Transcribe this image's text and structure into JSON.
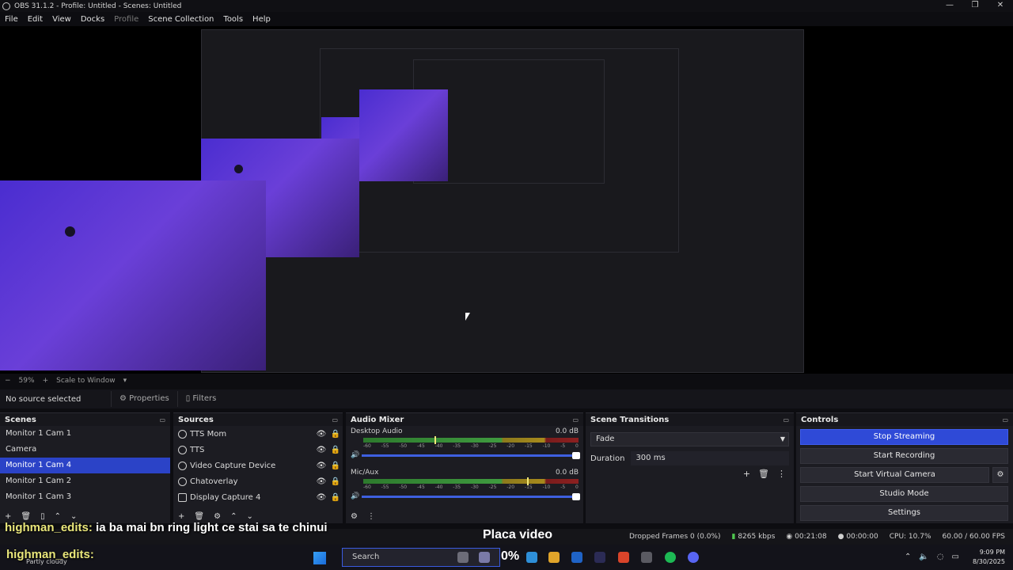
{
  "window": {
    "title": "OBS 31.1.2 - Profile: Untitled - Scenes: Untitled"
  },
  "menu": [
    "File",
    "Edit",
    "View",
    "Docks",
    "Profile",
    "Scene Collection",
    "Tools",
    "Help"
  ],
  "preview_toolbar": {
    "zoom": "59%",
    "scale_mode": "Scale to Window"
  },
  "source_bar": {
    "status": "No source selected",
    "properties": "Properties",
    "filters": "Filters"
  },
  "scenes": {
    "title": "Scenes",
    "items": [
      "Monitor 1 Cam 1",
      "Camera",
      "Monitor 1 Cam 4",
      "Monitor 1 Cam 2",
      "Monitor 1 Cam 3"
    ],
    "selected_index": 2
  },
  "sources": {
    "title": "Sources",
    "items": [
      "TTS Mom",
      "TTS",
      "Video Capture Device",
      "Chatoverlay",
      "Display Capture 4"
    ]
  },
  "mixer": {
    "title": "Audio Mixer",
    "channels": [
      {
        "name": "Desktop Audio",
        "db": "0.0 dB",
        "peak_fraction": 0.33
      },
      {
        "name": "Mic/Aux",
        "db": "0.0 dB",
        "peak_fraction": 0.76
      }
    ],
    "scale": [
      "-60",
      "-55",
      "-50",
      "-45",
      "-40",
      "-35",
      "-30",
      "-25",
      "-20",
      "-15",
      "-10",
      "-5",
      "0"
    ]
  },
  "transitions": {
    "title": "Scene Transitions",
    "selected": "Fade",
    "duration_label": "Duration",
    "duration_value": "300 ms"
  },
  "controls": {
    "title": "Controls",
    "stop_streaming": "Stop Streaming",
    "start_recording": "Start Recording",
    "start_virtual_camera": "Start Virtual Camera",
    "studio_mode": "Studio Mode",
    "settings": "Settings"
  },
  "status": {
    "dropped": "Dropped Frames 0 (0.0%)",
    "bitrate": "8265 kbps",
    "stream_time": "00:21:08",
    "rec_time": "00:00:00",
    "cpu": "CPU: 10.7%",
    "fps": "60.00 / 60.00 FPS"
  },
  "overlay": {
    "chat_user": "highman_edits:",
    "chat_message": "ia ba mai bn ring light ce stai sa te chinui",
    "title": "Placa video",
    "percent": "0%",
    "weather": "Partly cloudy"
  },
  "taskbar": {
    "search": "Search",
    "time": "9:09 PM",
    "date": "8/30/2025"
  },
  "colors": {
    "accent": "#2f4ad7",
    "selected": "#2b43c7",
    "panel": "#1c1c22",
    "meter_green": "#3f9a3f",
    "meter_yellow": "#a88a1c",
    "meter_red": "#8c2020"
  }
}
